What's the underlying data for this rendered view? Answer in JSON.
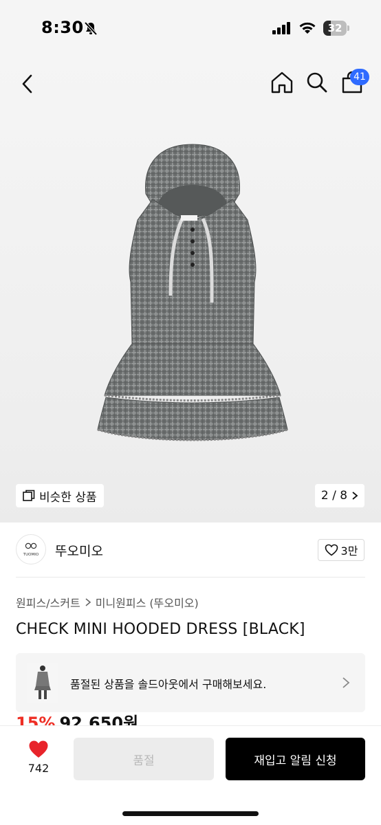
{
  "status_bar": {
    "time": "8:30",
    "battery": "32",
    "battery_level_percent": 32
  },
  "header": {
    "cart_count": "41",
    "icons": [
      "back-icon",
      "home-icon",
      "search-icon",
      "cart-icon"
    ]
  },
  "gallery": {
    "similar_label": "비슷한 상품",
    "page_indicator": "2 / 8"
  },
  "brand": {
    "name": "뚜오미오",
    "logo_text": "TUOMIO",
    "likes": "3만"
  },
  "breadcrumb": {
    "category": "원피스/스커트",
    "subcategory": "미니원피스 (뚜오미오)"
  },
  "product": {
    "title": "CHECK MINI HOODED DRESS [BLACK]",
    "discount": "15%",
    "price": "92,650원"
  },
  "soldout_banner": {
    "text": "품절된 상품을 솔드아웃에서 구매해보세요."
  },
  "action_bar": {
    "wish_count": "742",
    "soldout_label": "품절",
    "restock_label": "재입고 알림 신청"
  },
  "colors": {
    "accent_blue": "#2f6bff",
    "discount_red": "#ee2e24",
    "heart_red": "#e8242b"
  }
}
